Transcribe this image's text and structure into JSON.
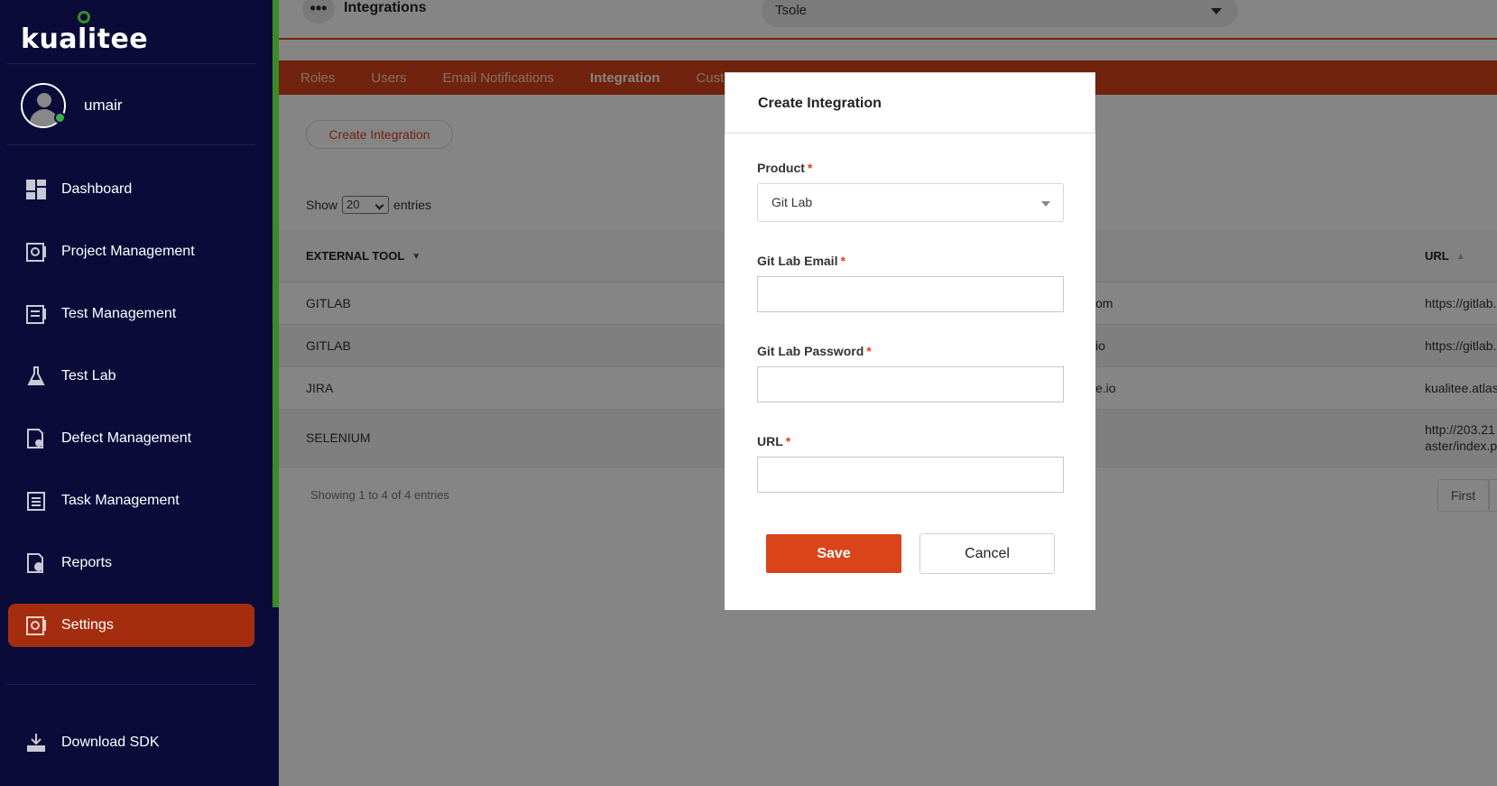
{
  "app": {
    "logo_text": "kualitee"
  },
  "user": {
    "name": "umair"
  },
  "sidebar": {
    "items": [
      {
        "label": "Dashboard",
        "icon": "dashboard-icon"
      },
      {
        "label": "Project Management",
        "icon": "project-management-icon"
      },
      {
        "label": "Test Management",
        "icon": "test-management-icon"
      },
      {
        "label": "Test Lab",
        "icon": "flask-icon"
      },
      {
        "label": "Defect Management",
        "icon": "defect-icon"
      },
      {
        "label": "Task Management",
        "icon": "task-icon"
      },
      {
        "label": "Reports",
        "icon": "reports-icon"
      },
      {
        "label": "Settings",
        "icon": "settings-icon",
        "active": true
      }
    ],
    "download_sdk": "Download SDK"
  },
  "header": {
    "title": "Integrations",
    "project_select": "Tsole"
  },
  "tabs": [
    {
      "label": "Roles"
    },
    {
      "label": "Users"
    },
    {
      "label": "Email Notifications"
    },
    {
      "label": "Integration",
      "active": true
    },
    {
      "label": "Cust"
    }
  ],
  "toolbar": {
    "create_label": "Create Integration"
  },
  "entries": {
    "show_label": "Show",
    "value": "20",
    "entries_label": "entries"
  },
  "table": {
    "columns": [
      "EXTERNAL TOOL",
      "URL"
    ],
    "rows": [
      {
        "tool": "GITLAB",
        "email": "om",
        "url": "https://gitlab."
      },
      {
        "tool": "GITLAB",
        "email": "io",
        "url": "https://gitlab."
      },
      {
        "tool": "JIRA",
        "email": "e.io",
        "url": "kualitee.atlas"
      },
      {
        "tool": "SELENIUM",
        "email": "",
        "url": "http://203.21",
        "url2": "aster/index.p"
      }
    ],
    "showing": "Showing 1 to 4 of 4 entries",
    "first_label": "First"
  },
  "modal": {
    "title": "Create Integration",
    "product_label": "Product",
    "product_value": "Git Lab",
    "email_label": "Git Lab Email",
    "password_label": "Git Lab Password",
    "url_label": "URL",
    "required_mark": "*",
    "save_label": "Save",
    "cancel_label": "Cancel"
  },
  "colors": {
    "sidebar_bg": "#0b0b3a",
    "accent": "#d9441a",
    "active_nav": "#a52d0f",
    "green_strip": "#3b8c24"
  }
}
